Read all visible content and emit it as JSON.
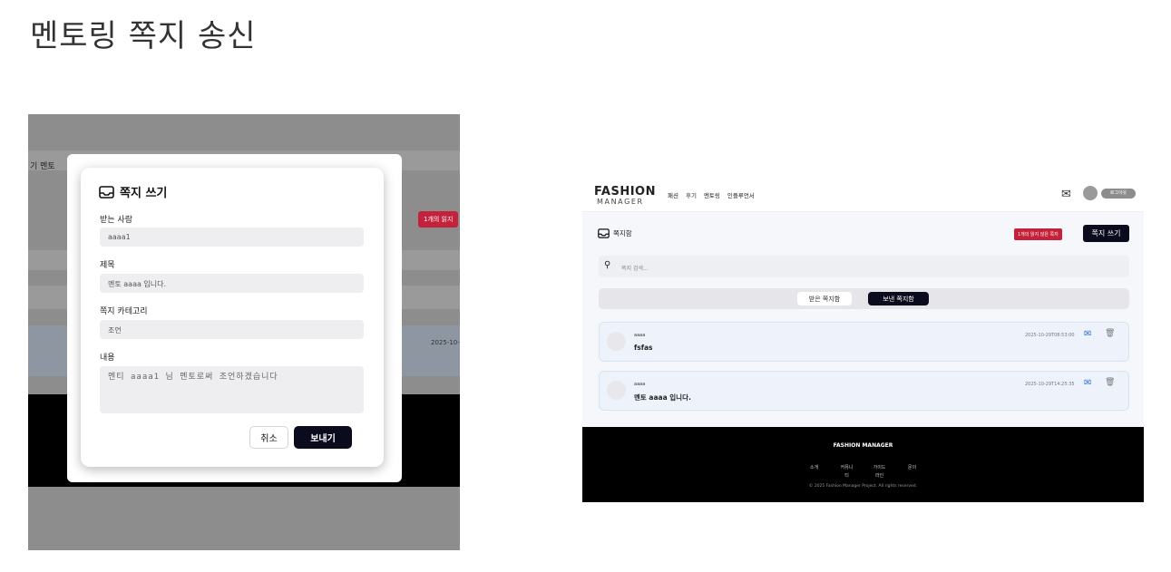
{
  "slide": {
    "title": "멘토링 쪽지 송신"
  },
  "left_screen": {
    "background": {
      "nav_text": "기  멘토",
      "unread_badge": "1개의 읽지",
      "message_date": "2025-10-"
    },
    "modal": {
      "title": "쪽지 쓰기",
      "title_icon": "inbox-icon",
      "recipient_label": "받는 사람",
      "recipient_value": "aaaa1",
      "subject_label": "제목",
      "subject_value": "멘토 aaaa 입니다.",
      "category_label": "쪽지 카테고리",
      "category_value": "조언",
      "content_label": "내용",
      "content_value": "멘티 aaaa1 님 멘토로써 조언하겠습니다",
      "cancel_label": "취소",
      "send_label": "보내기"
    }
  },
  "right_screen": {
    "header": {
      "logo": "FASHION",
      "logo_sub": "MANAGER",
      "nav": [
        "패션",
        "후기",
        "멘토링",
        "인플루언서"
      ],
      "mail_icon": "envelope-icon",
      "logout_label": "로그아웃"
    },
    "mailbox": {
      "title": "쪽지함",
      "unread_badge": "1개의 읽지 않은 쪽지",
      "write_label": "쪽지 쓰기",
      "search_placeholder": "쪽지 검색...",
      "tab_received": "받은 쪽지함",
      "tab_sent": "보낸 쪽지함",
      "active_tab": "보낸 쪽지함",
      "messages": [
        {
          "from": "aaaa",
          "subject": "fsfas",
          "date": "2025-10-29T08:53:00"
        },
        {
          "from": "aaaa",
          "subject": "멘토 aaaa 입니다.",
          "date": "2025-10-29T14:25:35"
        }
      ]
    },
    "footer": {
      "title": "FASHION MANAGER",
      "links": [
        "소개",
        "커뮤니티",
        "가이드라인",
        "문의"
      ],
      "copyright": "© 2025 Fashion Manager Project. All rights reserved."
    },
    "colors": {
      "accent_dark": "#0b0b1e",
      "badge_red": "#c4213a"
    }
  }
}
